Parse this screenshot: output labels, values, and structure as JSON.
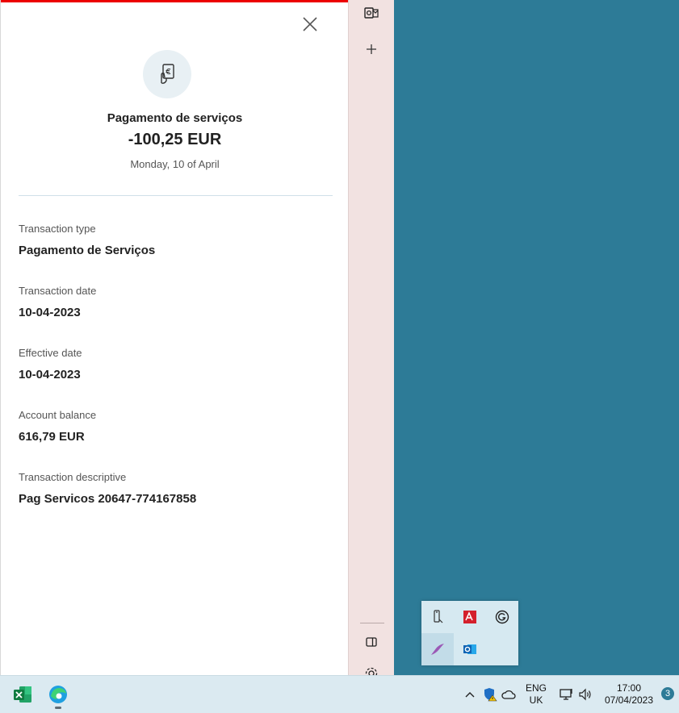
{
  "transaction": {
    "title": "Pagamento de serviços",
    "amount": "-100,25 EUR",
    "date": "Monday, 10 of April",
    "fields": [
      {
        "label": "Transaction type",
        "value": "Pagamento de Serviços"
      },
      {
        "label": "Transaction date",
        "value": "10-04-2023"
      },
      {
        "label": "Effective date",
        "value": "10-04-2023"
      },
      {
        "label": "Account balance",
        "value": "616,79 EUR"
      },
      {
        "label": "Transaction descriptive",
        "value": "Pag Servicos 20647-774167858"
      }
    ],
    "icons": [
      "close-icon",
      "euro-receipt-icon"
    ]
  },
  "sidebar": {
    "icons": [
      "outlook-icon",
      "plus-icon",
      "panel-toggle-icon",
      "settings-icon"
    ]
  },
  "tray_popup": {
    "icons": [
      "usb-icon",
      "red-app-icon",
      "grammarly-icon",
      "feather-icon",
      "outlook-icon"
    ]
  },
  "taskbar": {
    "apps": [
      "excel-icon",
      "edge-icon"
    ],
    "system_icons": [
      "chevron-up-icon",
      "security-warning-icon",
      "cloud-icon",
      "network-icon",
      "volume-icon"
    ],
    "language_line1": "ENG",
    "language_line2": "UK",
    "time": "17:00",
    "date": "07/04/2023",
    "notification_count": "3"
  },
  "colors": {
    "desktop": "#2d7b97",
    "accent_red": "#ec0000",
    "sidebar": "#f2e2e1",
    "taskbar": "#dbeaf1"
  }
}
